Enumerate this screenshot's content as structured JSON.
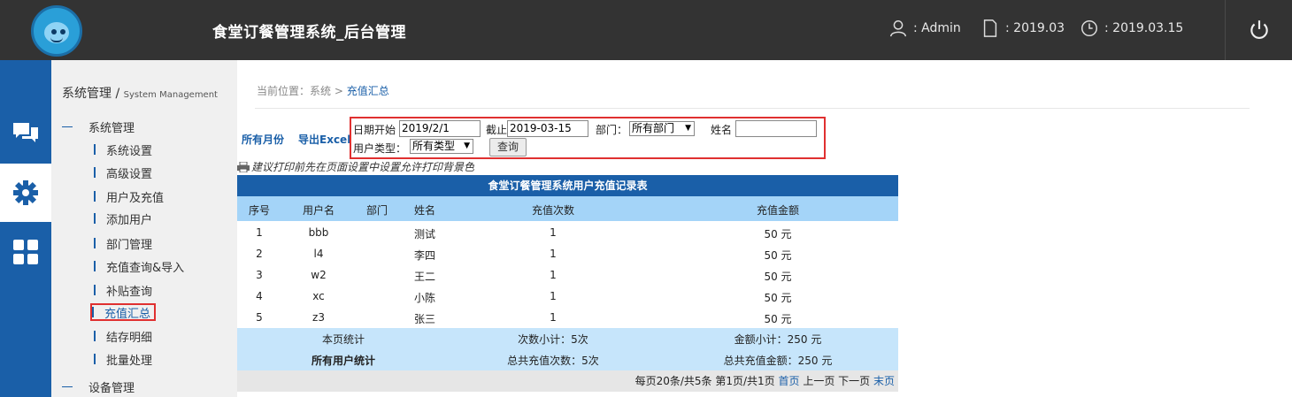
{
  "header": {
    "title": "食堂订餐管理系统_后台管理",
    "user_label": ": Admin",
    "month_label": ": 2019.03",
    "date_label": ": 2019.03.15"
  },
  "sidebar": {
    "title": "系统管理 /",
    "title_en": "System Management",
    "group1": "系统管理",
    "items": [
      "系统设置",
      "高级设置",
      "用户及充值",
      "添加用户",
      "部门管理",
      "充值查询&导入",
      "补贴查询",
      "充值汇总",
      "结存明细",
      "批量处理"
    ],
    "group2": "设备管理"
  },
  "breadcrumb": {
    "prefix": "当前位置：系统 > ",
    "current": "充值汇总"
  },
  "toolbar": {
    "all_months": "所有月份",
    "export_excel": "导出Excel"
  },
  "filter": {
    "date_start_label": "日期开始",
    "date_start_value": "2019/2/1",
    "date_end_label": "截止",
    "date_end_value": "2019-03-15",
    "dept_label": "部门：",
    "dept_value": "所有部门",
    "name_label": "姓名",
    "name_value": "",
    "user_type_label": "用户类型：",
    "user_type_value": "所有类型",
    "query_button": "查询"
  },
  "tip": "建议打印前先在页面设置中设置允许打印背景色",
  "table": {
    "title": "食堂订餐管理系统用户充值记录表",
    "columns": [
      "序号",
      "用户名",
      "部门",
      "姓名",
      "充值次数",
      "充值金额"
    ],
    "rows": [
      [
        "1",
        "bbb",
        "",
        "测试",
        "1",
        "50 元"
      ],
      [
        "2",
        "l4",
        "",
        "李四",
        "1",
        "50 元"
      ],
      [
        "3",
        "w2",
        "",
        "王二",
        "1",
        "50 元"
      ],
      [
        "4",
        "xc",
        "",
        "小陈",
        "1",
        "50 元"
      ],
      [
        "5",
        "z3",
        "",
        "张三",
        "1",
        "50 元"
      ]
    ],
    "page_stats_label": "本页统计",
    "page_count": "次数小计：5次",
    "page_amount": "金额小计：250 元",
    "all_stats_label": "所有用户统计",
    "all_count": "总共充值次数：5次",
    "all_amount": "总共充值金额：250 元"
  },
  "pager": {
    "info": "每页20条/共5条 第1页/共1页 ",
    "first": "首页",
    "prev": " 上一页 ",
    "next": "下一页 ",
    "last": "末页"
  },
  "colors": {
    "topbar": "#333333",
    "accent": "#1a5fa8",
    "header_row": "#a4d4f8",
    "summary": "#c6e5fb",
    "highlight": "#e03030"
  }
}
